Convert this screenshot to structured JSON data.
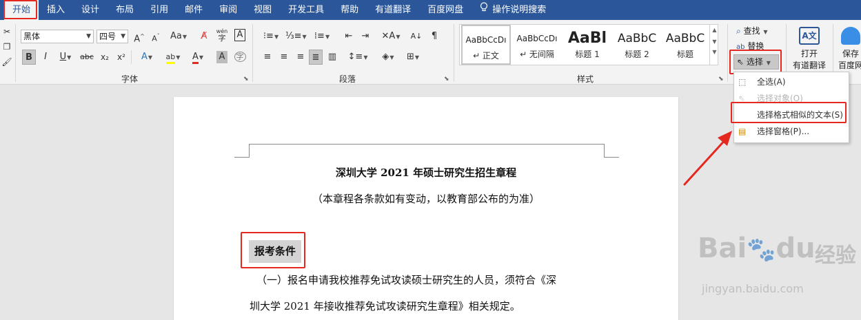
{
  "tabs": [
    {
      "label": "开始"
    },
    {
      "label": "插入"
    },
    {
      "label": "设计"
    },
    {
      "label": "布局"
    },
    {
      "label": "引用"
    },
    {
      "label": "邮件"
    },
    {
      "label": "审阅"
    },
    {
      "label": "视图"
    },
    {
      "label": "开发工具"
    },
    {
      "label": "帮助"
    },
    {
      "label": "有道翻译"
    },
    {
      "label": "百度网盘"
    },
    {
      "label": "操作说明搜索"
    }
  ],
  "font": {
    "family_value": "黑体",
    "size_value": "四号",
    "group_label": "字体",
    "case_label": "Aa",
    "phonetic_label": "wén",
    "buttons": {
      "bold": "B",
      "italic": "I",
      "underline": "U",
      "strike": "abc",
      "sub": "x₂",
      "sup": "x²",
      "grow": "A",
      "shrink": "A",
      "effects": "A",
      "highlight": "ab",
      "color": "A",
      "shading": "A",
      "border_char": "A",
      "enclose": "字"
    }
  },
  "paragraph": {
    "group_label": "段落"
  },
  "styles": {
    "group_label": "样式",
    "items": [
      {
        "sample": "AaBbCcDı",
        "name": "↵ 正文"
      },
      {
        "sample": "AaBbCcDı",
        "name": "↵ 无间隔"
      },
      {
        "sample": "AaBl",
        "name": "标题 1"
      },
      {
        "sample": "AaBbC",
        "name": "标题 2"
      },
      {
        "sample": "AaBbC",
        "name": "标题"
      }
    ]
  },
  "editing": {
    "find_label": "查找",
    "replace_label": "替换",
    "select_label": "选择"
  },
  "youdao": {
    "line1": "打开",
    "line2": "有道翻译"
  },
  "baidu": {
    "line1": "保存",
    "line2": "百度网"
  },
  "select_menu": {
    "items": [
      {
        "label": "全选(A)",
        "disabled": false
      },
      {
        "label": "选择对象(O)",
        "disabled": true
      },
      {
        "label": "选择格式相似的文本(S)",
        "disabled": false
      },
      {
        "label": "选择窗格(P)...",
        "disabled": false
      }
    ]
  },
  "document": {
    "title": "深圳大学 2021 年硕士研究生招生章程",
    "subtitle": "（本章程各条款如有变动，以教育部公布的为准）",
    "heading": "报考条件",
    "para_line1": "（一）报名申请我校推荐免试攻读硕士研究生的人员，须符合《深",
    "para_line2": "圳大学 2021 年接收推荐免试攻读研究生章程》相关规定。"
  },
  "watermark": {
    "brand": "Bai",
    "brand2": "du",
    "cn": "经验",
    "url": "jingyan.baidu.com"
  },
  "colors": {
    "accent": "#2b579a",
    "highlight_box": "#e5281f",
    "font_color_bar": "#e5281f",
    "highlight_bar": "#ffff00"
  }
}
